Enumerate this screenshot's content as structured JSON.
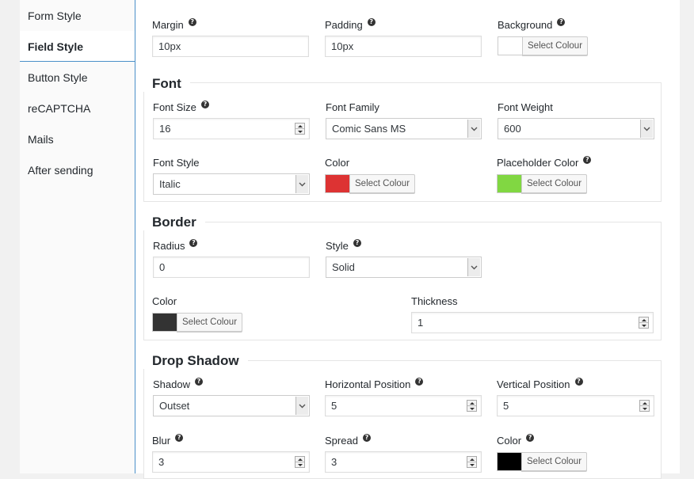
{
  "sidebar": {
    "items": [
      {
        "label": "Form Style"
      },
      {
        "label": "Field Style"
      },
      {
        "label": "Button Style"
      },
      {
        "label": "reCAPTCHA"
      },
      {
        "label": "Mails"
      },
      {
        "label": "After sending"
      }
    ]
  },
  "general": {
    "margin": {
      "label": "Margin",
      "value": "10px"
    },
    "padding": {
      "label": "Padding",
      "value": "10px"
    },
    "background": {
      "label": "Background",
      "button": "Select Colour",
      "color": "#ffffff"
    }
  },
  "font": {
    "title": "Font",
    "size": {
      "label": "Font Size",
      "value": "16"
    },
    "family": {
      "label": "Font Family",
      "value": "Comic Sans MS"
    },
    "weight": {
      "label": "Font Weight",
      "value": "600"
    },
    "style": {
      "label": "Font Style",
      "value": "Italic"
    },
    "color": {
      "label": "Color",
      "button": "Select Colour",
      "color": "#dd3333"
    },
    "placeholder_color": {
      "label": "Placeholder Color",
      "button": "Select Colour",
      "color": "#81d742"
    }
  },
  "border": {
    "title": "Border",
    "radius": {
      "label": "Radius",
      "value": "0"
    },
    "style": {
      "label": "Style",
      "value": "Solid"
    },
    "color": {
      "label": "Color",
      "button": "Select Colour",
      "color": "#333333"
    },
    "thickness": {
      "label": "Thickness",
      "value": "1"
    }
  },
  "shadow": {
    "title": "Drop Shadow",
    "shadow": {
      "label": "Shadow",
      "value": "Outset"
    },
    "h_position": {
      "label": "Horizontal Position",
      "value": "5"
    },
    "v_position": {
      "label": "Vertical Position",
      "value": "5"
    },
    "blur": {
      "label": "Blur",
      "value": "3"
    },
    "spread": {
      "label": "Spread",
      "value": "3"
    },
    "color": {
      "label": "Color",
      "button": "Select Colour",
      "color": "#000000"
    }
  },
  "colors": {
    "accent": "#4a90c8"
  }
}
